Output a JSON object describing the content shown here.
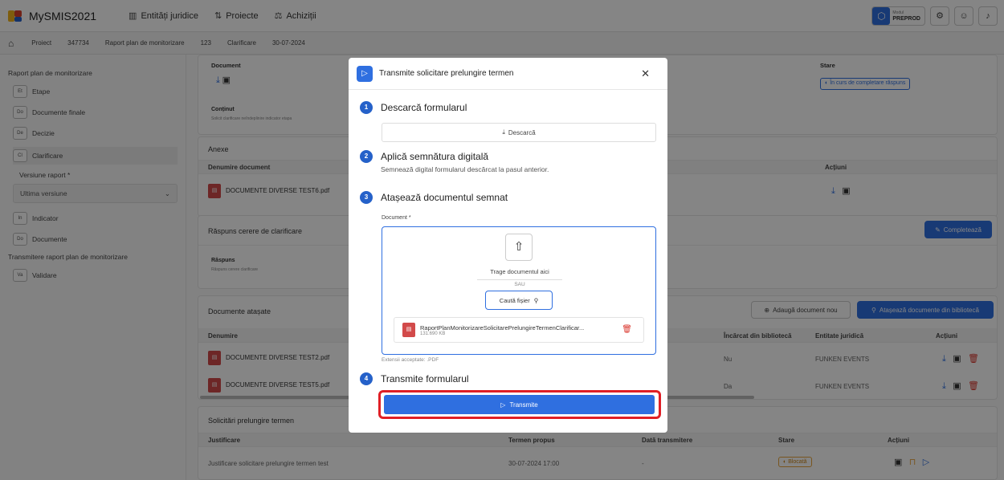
{
  "app": {
    "title": "MySMIS2021"
  },
  "nav": [
    {
      "label": "Entități juridice",
      "icon": "building-icon"
    },
    {
      "label": "Proiecte",
      "icon": "projects-icon"
    },
    {
      "label": "Achiziții",
      "icon": "acquisitions-icon"
    }
  ],
  "mode": {
    "label": "Modul",
    "value": "PREPROD"
  },
  "breadcrumb": [
    "Proiect",
    "347734",
    "Raport plan de monitorizare",
    "123",
    "Clarificare",
    "30-07-2024"
  ],
  "sidebar": {
    "section1": "Raport plan de monitorizare",
    "items1": [
      {
        "badge": "Et",
        "label": "Etape"
      },
      {
        "badge": "Do",
        "label": "Documente finale"
      },
      {
        "badge": "De",
        "label": "Decizie"
      },
      {
        "badge": "Cl",
        "label": "Clarificare"
      }
    ],
    "version_label": "Versiune raport *",
    "version_value": "Ultima versiune",
    "items2": [
      {
        "badge": "In",
        "label": "Indicator"
      },
      {
        "badge": "Do",
        "label": "Documente"
      }
    ],
    "section2": "Transmitere raport plan de monitorizare",
    "items3": [
      {
        "badge": "Va",
        "label": "Validare"
      }
    ]
  },
  "main": {
    "doc_label": "Document",
    "status_label": "Stare",
    "status_value": "În curs de completare răspuns",
    "content_label": "Conținut",
    "content_value": "Solicit clarificare neîndeplinire indicator etapa",
    "annex_title": "Anexe",
    "annex_col_name": "Denumire document",
    "annex_col_actions": "Acțiuni",
    "annex_file": "DOCUMENTE DIVERSE TEST6.pdf",
    "answer_title": "Răspuns cerere de clarificare",
    "answer_label": "Răspuns",
    "answer_value": "Răspuns cerere clarificare",
    "complete_btn": "Completează",
    "attached_title": "Documente atașate",
    "add_doc_btn": "Adaugă document nou",
    "attach_lib_btn": "Atașează documente din bibliotecă",
    "att_cols": {
      "name": "Denumire",
      "lib": "Încărcat din bibliotecă",
      "entity": "Entitate juridică",
      "actions": "Acțiuni"
    },
    "att_rows": [
      {
        "name": "DOCUMENTE DIVERSE TEST2.pdf",
        "lib": "Nu",
        "entity": "FUNKEN EVENTS"
      },
      {
        "name": "DOCUMENTE DIVERSE TEST5.pdf",
        "lib": "Da",
        "entity": "FUNKEN EVENTS"
      }
    ],
    "ext_title": "Solicitări prelungire termen",
    "ext_cols": {
      "just": "Justificare",
      "term": "Termen propus",
      "date": "Dată transmitere",
      "status": "Stare",
      "actions": "Acțiuni"
    },
    "ext_row": {
      "just": "Justificare solicitare prelungire termen test",
      "term": "30-07-2024 17:00",
      "date": "-",
      "status": "Blocată"
    }
  },
  "modal": {
    "title": "Transmite solicitare prelungire termen",
    "step1_num": "1",
    "step1_title": "Descarcă formularul",
    "download_btn": "Descarcă",
    "step2_num": "2",
    "step2_title": "Aplică semnătura digitală",
    "step2_desc": "Semnează digital formularul descărcat la pasul anterior.",
    "step3_num": "3",
    "step3_title": "Atașează documentul semnat",
    "doc_field_label": "Document *",
    "drop_text": "Trage documentul aici",
    "or_text": "SAU",
    "browse_btn": "Caută fișier",
    "file_name": "RaportPlanMonitorizareSolicitarePrelungireTermenClarificar...",
    "file_size": "131.690 KB",
    "ext_note": "Extensii acceptate: .PDF",
    "step4_num": "4",
    "step4_title": "Transmite formularul",
    "send_btn": "Transmite"
  },
  "colors": {
    "accent": "#2f6fe0",
    "highlight": "#e01f26",
    "danger": "#d9342b"
  }
}
